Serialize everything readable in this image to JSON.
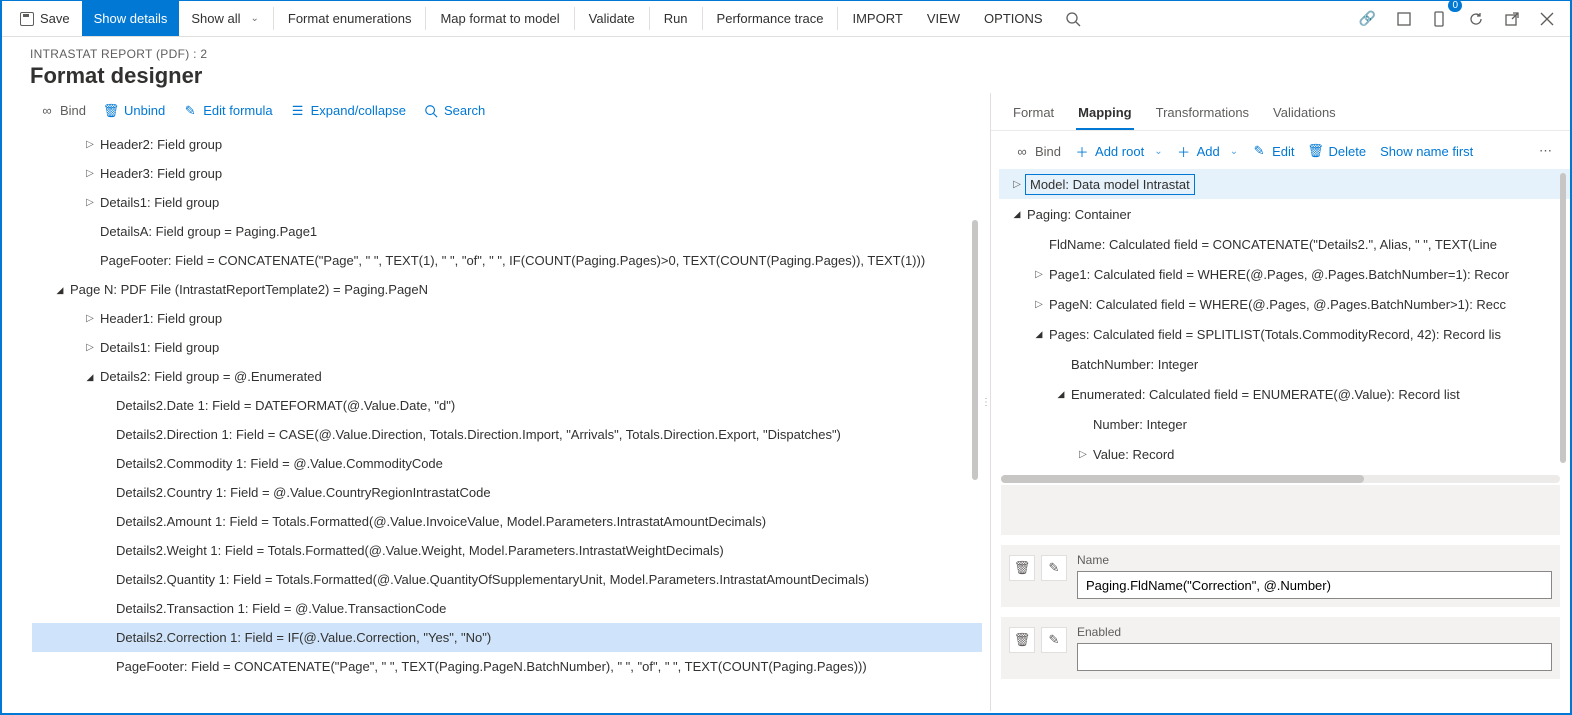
{
  "ribbon": {
    "save": "Save",
    "show_details": "Show details",
    "show_all": "Show all",
    "format_enum": "Format enumerations",
    "map_format": "Map format to model",
    "validate": "Validate",
    "run": "Run",
    "perf_trace": "Performance trace",
    "import": "IMPORT",
    "view": "VIEW",
    "options": "OPTIONS",
    "badge": "0"
  },
  "header": {
    "breadcrumb": "INTRASTAT REPORT (PDF) : 2",
    "title": "Format designer"
  },
  "left_toolbar": {
    "bind": "Bind",
    "unbind": "Unbind",
    "edit_formula": "Edit formula",
    "expand": "Expand/collapse",
    "search": "Search"
  },
  "left_tree": [
    {
      "indent": 1,
      "caret": "right",
      "text": "Header2: Field group"
    },
    {
      "indent": 1,
      "caret": "right",
      "text": "Header3: Field group"
    },
    {
      "indent": 1,
      "caret": "right",
      "text": "Details1: Field group"
    },
    {
      "indent": 1,
      "caret": "none",
      "text": "DetailsA: Field group = Paging.Page1"
    },
    {
      "indent": 1,
      "caret": "none",
      "text": "PageFooter: Field = CONCATENATE(\"Page\", \" \", TEXT(1), \" \", \"of\", \" \", IF(COUNT(Paging.Pages)>0, TEXT(COUNT(Paging.Pages)), TEXT(1)))"
    },
    {
      "indent": 0,
      "caret": "down",
      "text": "Page N: PDF File (IntrastatReportTemplate2) = Paging.PageN"
    },
    {
      "indent": 1,
      "caret": "right",
      "text": "Header1: Field group"
    },
    {
      "indent": 1,
      "caret": "right",
      "text": "Details1: Field group"
    },
    {
      "indent": 1,
      "caret": "down",
      "text": "Details2: Field group = @.Enumerated"
    },
    {
      "indent": 2,
      "caret": "none",
      "text": "Details2.Date 1: Field = DATEFORMAT(@.Value.Date, \"d\")"
    },
    {
      "indent": 2,
      "caret": "none",
      "text": "Details2.Direction 1: Field = CASE(@.Value.Direction, Totals.Direction.Import, \"Arrivals\", Totals.Direction.Export, \"Dispatches\")"
    },
    {
      "indent": 2,
      "caret": "none",
      "text": "Details2.Commodity 1: Field = @.Value.CommodityCode"
    },
    {
      "indent": 2,
      "caret": "none",
      "text": "Details2.Country 1: Field = @.Value.CountryRegionIntrastatCode"
    },
    {
      "indent": 2,
      "caret": "none",
      "text": "Details2.Amount 1: Field = Totals.Formatted(@.Value.InvoiceValue, Model.Parameters.IntrastatAmountDecimals)"
    },
    {
      "indent": 2,
      "caret": "none",
      "text": "Details2.Weight 1: Field = Totals.Formatted(@.Value.Weight, Model.Parameters.IntrastatWeightDecimals)"
    },
    {
      "indent": 2,
      "caret": "none",
      "text": "Details2.Quantity 1: Field = Totals.Formatted(@.Value.QuantityOfSupplementaryUnit, Model.Parameters.IntrastatAmountDecimals)"
    },
    {
      "indent": 2,
      "caret": "none",
      "text": "Details2.Transaction 1: Field = @.Value.TransactionCode"
    },
    {
      "indent": 2,
      "caret": "none",
      "text": "Details2.Correction 1: Field = IF(@.Value.Correction, \"Yes\", \"No\")",
      "selected": true
    },
    {
      "indent": 2,
      "caret": "none",
      "text": "PageFooter: Field = CONCATENATE(\"Page\", \" \", TEXT(Paging.PageN.BatchNumber), \" \", \"of\", \" \", TEXT(COUNT(Paging.Pages)))"
    }
  ],
  "right_tabs": {
    "format": "Format",
    "mapping": "Mapping",
    "transformations": "Transformations",
    "validations": "Validations"
  },
  "right_toolbar": {
    "bind": "Bind",
    "add_root": "Add root",
    "add": "Add",
    "edit": "Edit",
    "delete": "Delete",
    "show_name": "Show name first"
  },
  "right_tree": [
    {
      "indent": 0,
      "caret": "right",
      "text": "Model: Data model Intrastat",
      "selbox": true
    },
    {
      "indent": 0,
      "caret": "down",
      "text": "Paging: Container"
    },
    {
      "indent": 1,
      "caret": "none",
      "text": "FldName: Calculated field = CONCATENATE(\"Details2.\", Alias, \" \", TEXT(Line"
    },
    {
      "indent": 1,
      "caret": "right",
      "text": "Page1: Calculated field = WHERE(@.Pages, @.Pages.BatchNumber=1): Recor"
    },
    {
      "indent": 1,
      "caret": "right",
      "text": "PageN: Calculated field = WHERE(@.Pages, @.Pages.BatchNumber>1): Recc"
    },
    {
      "indent": 1,
      "caret": "down",
      "text": "Pages: Calculated field = SPLITLIST(Totals.CommodityRecord, 42): Record lis"
    },
    {
      "indent": 2,
      "caret": "none",
      "text": "BatchNumber: Integer"
    },
    {
      "indent": 2,
      "caret": "down",
      "text": "Enumerated: Calculated field = ENUMERATE(@.Value): Record list"
    },
    {
      "indent": 3,
      "caret": "none",
      "text": "Number: Integer"
    },
    {
      "indent": 3,
      "caret": "right",
      "text": "Value: Record"
    }
  ],
  "props": {
    "name_label": "Name",
    "name_value": "Paging.FldName(\"Correction\", @.Number)",
    "enabled_label": "Enabled"
  }
}
